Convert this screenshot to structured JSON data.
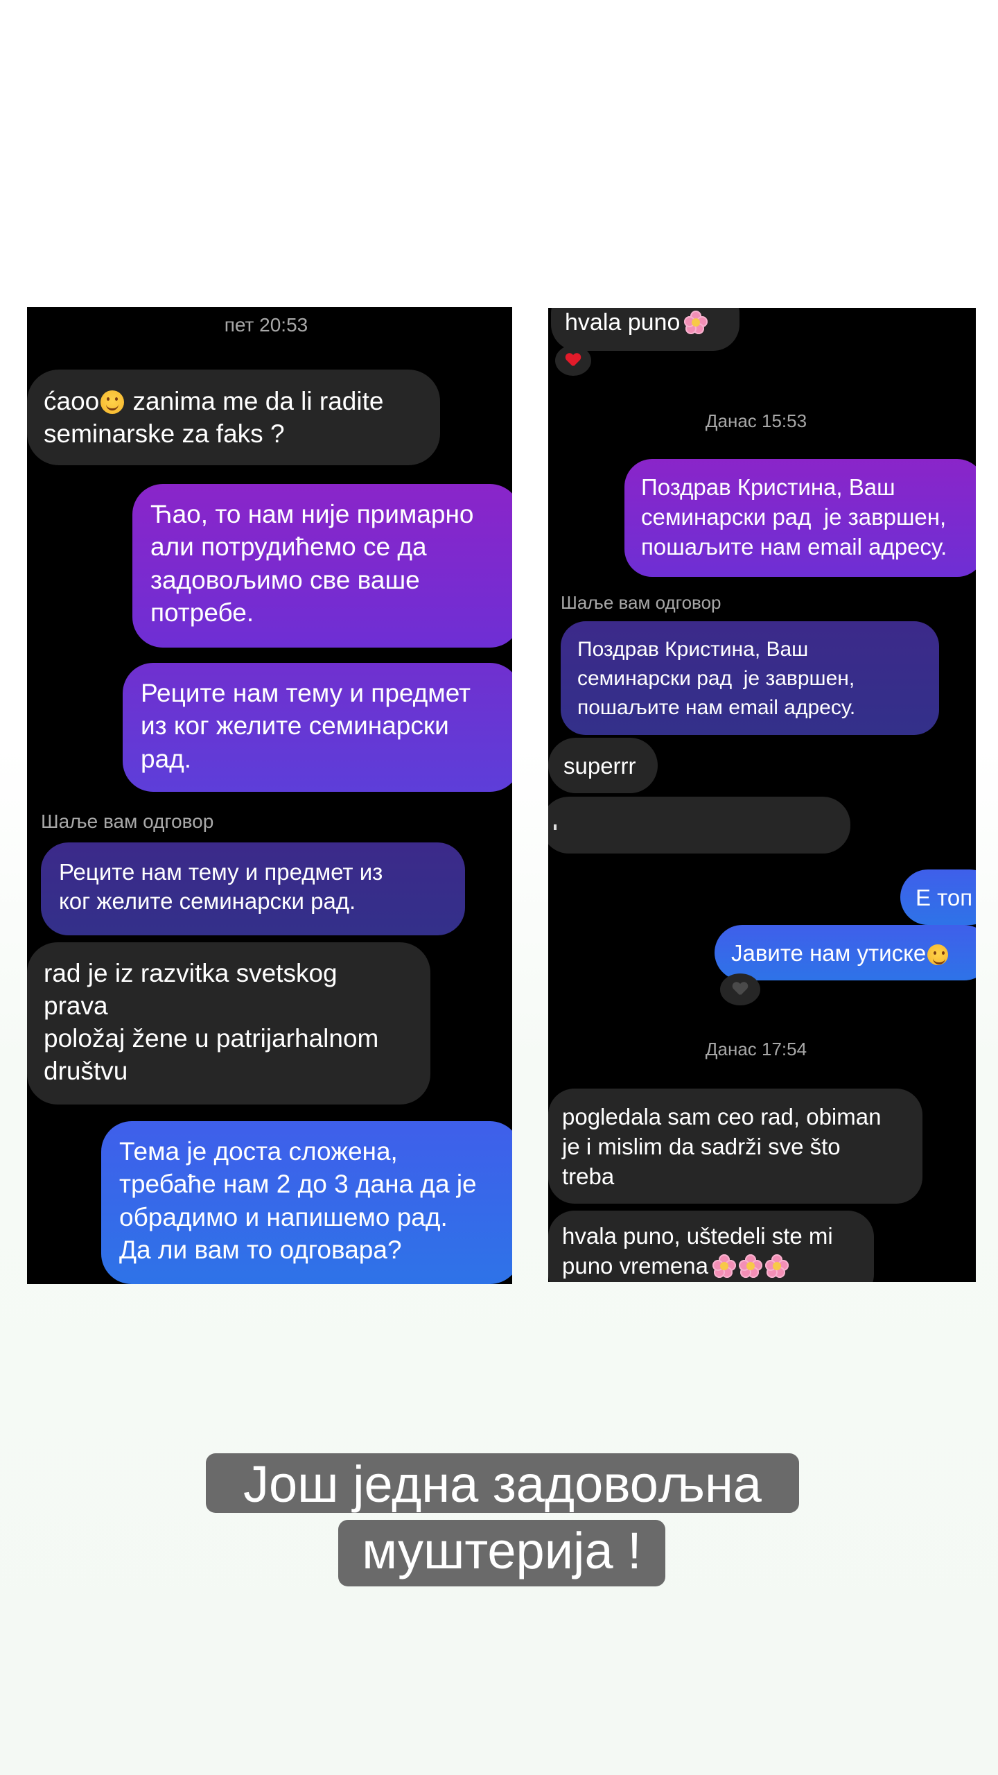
{
  "left_chat": {
    "timestamp": "пет 20:53",
    "messages": [
      {
        "from": "them",
        "text_before": "ćaoo",
        "text_after": " zanima me da li radite\nseminarske za faks ?"
      },
      {
        "from": "me",
        "text": "Ћао, то нам није примарно\nали потрудићемо се да\nзадовољимо све ваше\nпотребе."
      },
      {
        "from": "me",
        "text": "Реците нам тему и предмет\nиз ког желите семинарски\nрад."
      },
      {
        "from": "them",
        "text": "rad je iz razvitka svetskog\nprava\npoložaj žene u patrijarhalnom\ndruštvu"
      },
      {
        "from": "me",
        "text": "Тема је доста сложена,\nтребаће нам 2 до 3 дана да је\nобрадимо и напишемо рад.\nДа ли вам то одговара?"
      }
    ],
    "reply_label": "Шаље вам одговор",
    "quoted_text": "Реците нам тему и предмет из\nког желите семинарски рад."
  },
  "right_chat": {
    "top_message": "hvala puno",
    "timestamp_1": "Данас 15:53",
    "me_message_1": "Поздрав Кристина, Ваш\nсеминарски рад  је завршен,\nпошаљите нам email адресу.",
    "reply_label": "Шаље вам одговор",
    "quoted_text": "Поздрав Кристина, Ваш\nсеминарски рад  је завршен,\nпошаљите нам email адресу.",
    "them_message_1": "superrr",
    "me_message_2": "Е топ",
    "me_message_3": "Јавите нам утиске",
    "timestamp_2": "Данас 17:54",
    "them_message_2": "pogledala sam ceo rad, obiman\nje i mislim da sadrži sve što\ntreba",
    "them_message_3": "hvala puno, uštedeli ste mi\npuno vremena"
  },
  "caption": {
    "line1": "Још једна задовољна",
    "line2": "муштерија !"
  },
  "colors": {
    "incoming": "#262626",
    "outgoing_purple": "#8a25c9",
    "outgoing_blue": "#2e73e8",
    "caption_bg": "#6a6a6a"
  }
}
